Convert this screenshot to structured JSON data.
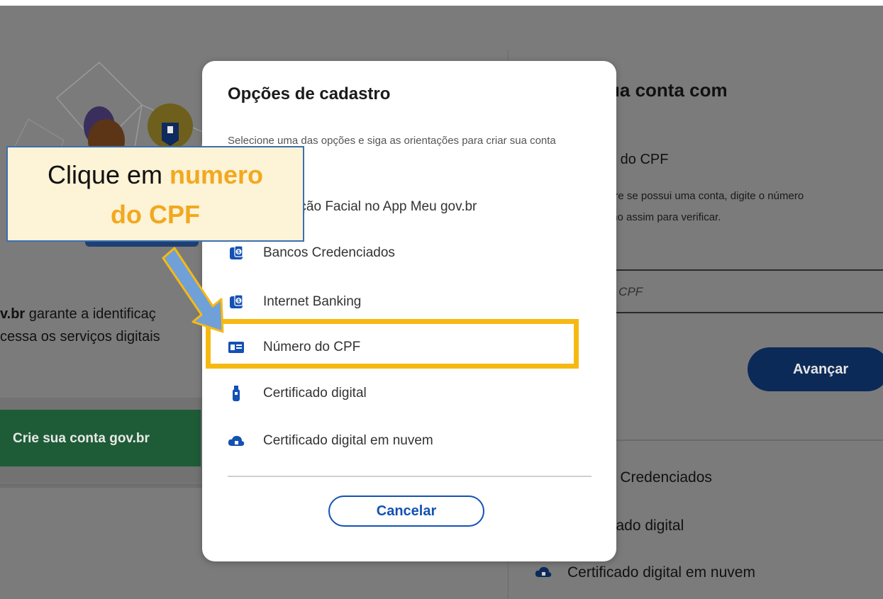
{
  "background_page": {
    "heading_partial": "ua conta com",
    "subheading_partial": "o do CPF",
    "hint_line1_partial": "bre se possui uma conta, digite o número",
    "hint_line2_partial": "mo assim para verificar.",
    "input_placeholder_partial": "u CPF",
    "advance_button": "Avançar",
    "alt_option_1_partial": "s Credenciados",
    "alt_option_2_partial": "cado digital",
    "alt_option_3": "Certificado digital em nuvem",
    "gov_text_line1_bold": "v.br",
    "gov_text_line1_rest": " garante a identificaç",
    "gov_text_line2": "cessa os serviços digitais",
    "create_account_button": "Crie sua conta gov.br"
  },
  "modal": {
    "title": "Opções de cadastro",
    "description": "Selecione uma das opções e siga as orientações para criar sua conta gov.br.",
    "options": [
      {
        "label": "Validação Facial no App Meu gov.br",
        "icon": "face-id-icon"
      },
      {
        "label": "Bancos Credenciados",
        "icon": "bank-icon"
      },
      {
        "label": "Internet Banking",
        "icon": "bank-icon"
      },
      {
        "label": "Número do CPF",
        "icon": "id-card-icon"
      },
      {
        "label": "Certificado digital",
        "icon": "usb-token-icon"
      },
      {
        "label": "Certificado digital em nuvem",
        "icon": "cloud-lock-icon"
      }
    ],
    "cancel_label": "Cancelar"
  },
  "annotation": {
    "callout_prefix": "Clique em ",
    "callout_highlight": "numero",
    "callout_line2": "do CPF",
    "highlight_color": "#f6b913",
    "arrow_color": "#6fa0d8"
  },
  "colors": {
    "gov_blue": "#1351b4",
    "overlay": "#7b7b7b"
  }
}
